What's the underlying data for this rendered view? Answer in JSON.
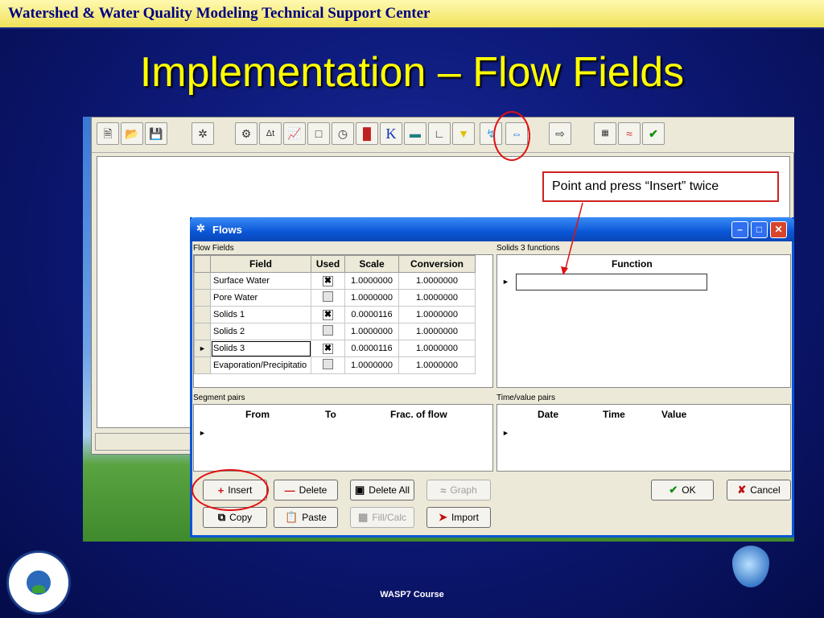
{
  "banner": {
    "text": "Watershed & Water Quality Modeling Technical Support Center"
  },
  "slide": {
    "title": "Implementation – Flow Fields",
    "footer": "WASP7 Course"
  },
  "callout": {
    "text": "Point and press “Insert” twice"
  },
  "toolbar": {
    "icons": [
      "new-file-icon",
      "open-folder-icon",
      "save-icon",
      "bug-icon",
      "gears-icon",
      "delta-t-icon",
      "line-chart-icon",
      "cube-icon",
      "clock-icon",
      "kinetics-icon",
      "k-constant-icon",
      "segments-icon",
      "axis-chart-icon",
      "load-icon",
      "flow-faucet-icon",
      "boundary-icon",
      "export-icon",
      "grid-icon",
      "graph-icon",
      "check-icon"
    ],
    "labels": {
      "delta_t": "Δt",
      "k": "K"
    }
  },
  "dialog": {
    "title": "Flows",
    "flow_fields_label": "Flow Fields",
    "solids_label": "Solids 3 functions",
    "segment_pairs_label": "Segment pairs",
    "time_value_label": "Time/value pairs",
    "columns": [
      "Field",
      "Used",
      "Scale",
      "Conversion"
    ],
    "rows": [
      {
        "field": "Surface Water",
        "used": true,
        "scale": "1.0000000",
        "conversion": "1.0000000",
        "current": false
      },
      {
        "field": "Pore Water",
        "used": false,
        "scale": "1.0000000",
        "conversion": "1.0000000",
        "current": false
      },
      {
        "field": "Solids 1",
        "used": true,
        "scale": "0.0000116",
        "conversion": "1.0000000",
        "current": false
      },
      {
        "field": "Solids 2",
        "used": false,
        "scale": "1.0000000",
        "conversion": "1.0000000",
        "current": false
      },
      {
        "field": "Solids 3",
        "used": true,
        "scale": "0.0000116",
        "conversion": "1.0000000",
        "current": true
      },
      {
        "field": "Evaporation/Precipitatio",
        "used": false,
        "scale": "1.0000000",
        "conversion": "1.0000000",
        "current": false
      }
    ],
    "function_header": "Function",
    "segment_headers": [
      "From",
      "To",
      "Frac. of flow"
    ],
    "timevalue_headers": [
      "Date",
      "Time",
      "Value"
    ],
    "buttons": {
      "insert": "Insert",
      "delete": "Delete",
      "delete_all": "Delete All",
      "graph": "Graph",
      "ok": "OK",
      "cancel": "Cancel",
      "copy": "Copy",
      "paste": "Paste",
      "fill_calc": "Fill/Calc",
      "import": "Import"
    }
  },
  "colors": {
    "title_yellow": "#ffff00",
    "callout_red": "#d02020",
    "xp_blue": "#0a56d6"
  }
}
